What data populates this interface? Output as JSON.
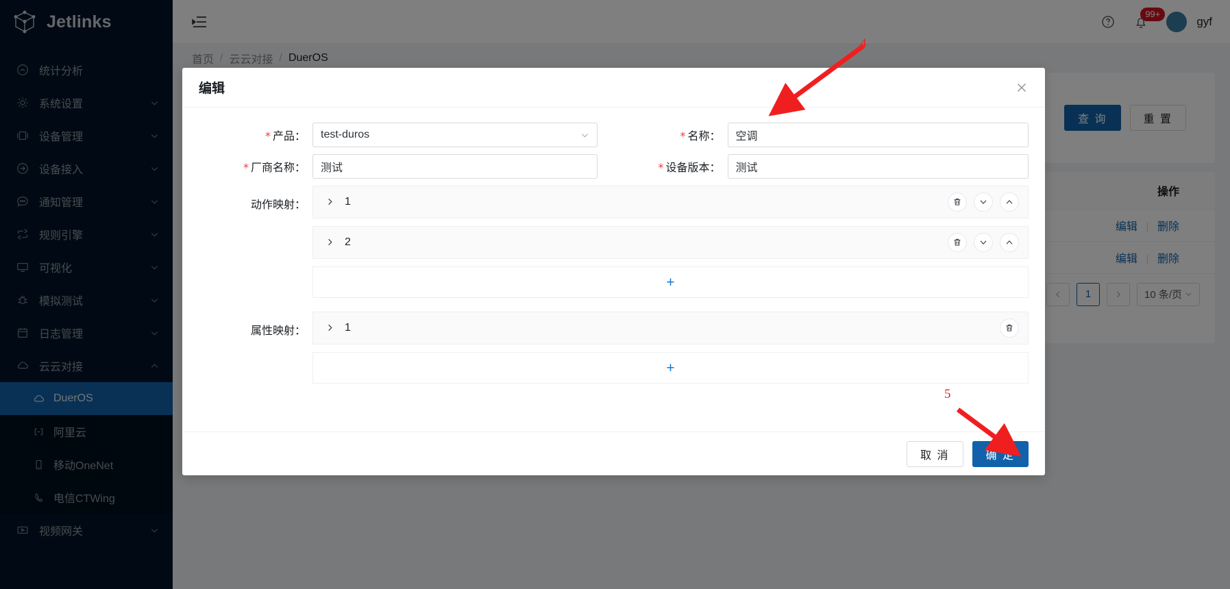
{
  "brand": {
    "name": "Jetlinks",
    "logo_icon": "cube-logo-icon"
  },
  "sidebar": {
    "items": [
      {
        "label": "统计分析",
        "icon": "dashboard-icon",
        "has_arrow": false
      },
      {
        "label": "系统设置",
        "icon": "gear-icon",
        "has_arrow": true
      },
      {
        "label": "设备管理",
        "icon": "device-icon",
        "has_arrow": true
      },
      {
        "label": "设备接入",
        "icon": "access-icon",
        "has_arrow": true
      },
      {
        "label": "通知管理",
        "icon": "message-icon",
        "has_arrow": true
      },
      {
        "label": "规则引擎",
        "icon": "rule-icon",
        "has_arrow": true
      },
      {
        "label": "可视化",
        "icon": "monitor-icon",
        "has_arrow": true
      },
      {
        "label": "模拟测试",
        "icon": "bug-icon",
        "has_arrow": true
      },
      {
        "label": "日志管理",
        "icon": "calendar-icon",
        "has_arrow": true
      },
      {
        "label": "云云对接",
        "icon": "cloud-icon",
        "has_arrow": true,
        "expanded": true
      },
      {
        "label": "视频网关",
        "icon": "video-icon",
        "has_arrow": true
      }
    ],
    "submenu": [
      {
        "label": "DuerOS",
        "icon": "cloud-icon",
        "active": true
      },
      {
        "label": "阿里云",
        "icon": "aliyun-icon",
        "active": false
      },
      {
        "label": "移动OneNet",
        "icon": "mobile-icon",
        "active": false
      },
      {
        "label": "电信CTWing",
        "icon": "phone-icon",
        "active": false
      }
    ]
  },
  "topbar": {
    "collapse_icon": "menu-fold-icon",
    "help_icon": "question-circle-icon",
    "bell_icon": "bell-icon",
    "badge": "99+",
    "avatar_icon": "avatar",
    "username": "gyf"
  },
  "breadcrumb": {
    "items": [
      "首页",
      "云云对接",
      "DuerOS"
    ],
    "separator": "/"
  },
  "search_card": {
    "query_label": "查 询",
    "reset_label": "重 置"
  },
  "table": {
    "headers": [
      "操作"
    ],
    "rows": [
      {
        "edit": "编辑",
        "delete": "删除"
      },
      {
        "edit": "编辑",
        "delete": "删除"
      }
    ]
  },
  "pagination": {
    "prev_icon": "chevron-left-icon",
    "next_icon": "chevron-right-icon",
    "current_page": "1",
    "page_size": "10 条/页",
    "size_arrow_icon": "chevron-down-icon"
  },
  "modal": {
    "title": "编辑",
    "close_icon": "close-icon",
    "fields": [
      {
        "label": "产品：",
        "required": true,
        "value": "test-duros",
        "type": "select",
        "arrow_icon": "chevron-down-icon"
      },
      {
        "label": "名称：",
        "required": true,
        "value": "空调",
        "type": "input"
      },
      {
        "label": "厂商名称：",
        "required": true,
        "value": "测试",
        "type": "input"
      },
      {
        "label": "设备版本：",
        "required": true,
        "value": "测试",
        "type": "input"
      }
    ],
    "action_mapping": {
      "label": "动作映射：",
      "panels": [
        {
          "title": "1",
          "expand_icon": "chevron-right-icon",
          "actions": [
            "delete-icon",
            "move-down-icon",
            "move-up-icon"
          ]
        },
        {
          "title": "2",
          "expand_icon": "chevron-right-icon",
          "actions": [
            "delete-icon",
            "move-down-icon",
            "move-up-icon"
          ]
        }
      ],
      "add_label": "+"
    },
    "property_mapping": {
      "label": "属性映射：",
      "panels": [
        {
          "title": "1",
          "expand_icon": "chevron-right-icon",
          "actions": [
            "delete-icon"
          ]
        }
      ],
      "add_label": "+"
    },
    "cancel_label": "取 消",
    "confirm_label": "确 定"
  },
  "annotations": [
    {
      "number": "4",
      "target": "name-field"
    },
    {
      "number": "5",
      "target": "confirm-button"
    }
  ],
  "colors": {
    "sidebar_bg": "#021529",
    "submenu_bg": "#00101f",
    "active_blue": "#1162ab",
    "link_blue": "#1677d2",
    "badge_red": "#cf1322",
    "required_red": "#ef3b39",
    "annotation_red": "#f01f1f"
  }
}
